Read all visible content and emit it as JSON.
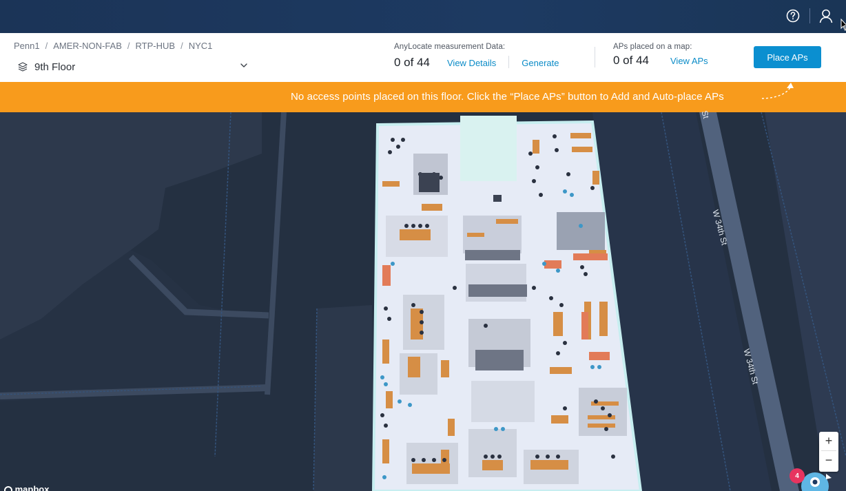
{
  "topbar": {
    "help_icon": "question-circle-icon",
    "user_icon": "user-icon"
  },
  "header": {
    "breadcrumb": [
      "Penn1",
      "AMER-NON-FAB",
      "RTP-HUB",
      "NYC1"
    ],
    "floor": "9th Floor",
    "anylocate": {
      "caption": "AnyLocate measurement Data:",
      "value": "0 of 44",
      "view_details": "View Details",
      "generate": "Generate"
    },
    "aps": {
      "caption": "APs placed on a map:",
      "value": "0 of 44",
      "view_aps": "View APs"
    },
    "place_button": "Place APs"
  },
  "banner": {
    "message": "No access points placed on this floor. Click the “Place APs” button to Add and Auto-place APs"
  },
  "map": {
    "streets": [
      "W 34th St",
      "W 34th St",
      "St"
    ],
    "zoom_in": "+",
    "zoom_out": "−",
    "notification_count": "4",
    "attribution": "mapbox"
  },
  "colors": {
    "accent": "#0b8fd0",
    "banner": "#f89b1c",
    "topbar": "#1d3a62",
    "map_background": "#1f2a3a"
  }
}
